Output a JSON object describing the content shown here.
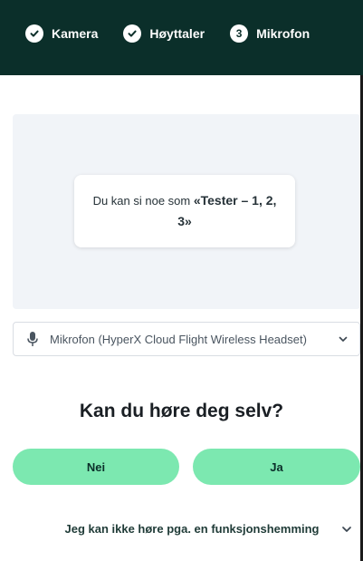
{
  "steps": [
    {
      "label": "Kamera",
      "state": "done",
      "icon": "check-icon"
    },
    {
      "label": "Høyttaler",
      "state": "done",
      "icon": "check-icon"
    },
    {
      "label": "Mikrofon",
      "state": "current",
      "number": "3"
    }
  ],
  "prompt": {
    "prefix": "Du kan si noe som ",
    "phrase": "«Tester – 1, 2, 3»"
  },
  "microphone": {
    "selected": "Mikrofon (HyperX Cloud Flight Wireless Headset)",
    "icon": "microphone-icon"
  },
  "question": "Kan du høre deg selv?",
  "buttons": {
    "no": "Nei",
    "yes": "Ja"
  },
  "accessibility": {
    "label": "Jeg kan ikke høre pga. en funksjonshemming"
  },
  "colors": {
    "header_bg": "#0b2f2a",
    "accent": "#7ce8b0"
  }
}
